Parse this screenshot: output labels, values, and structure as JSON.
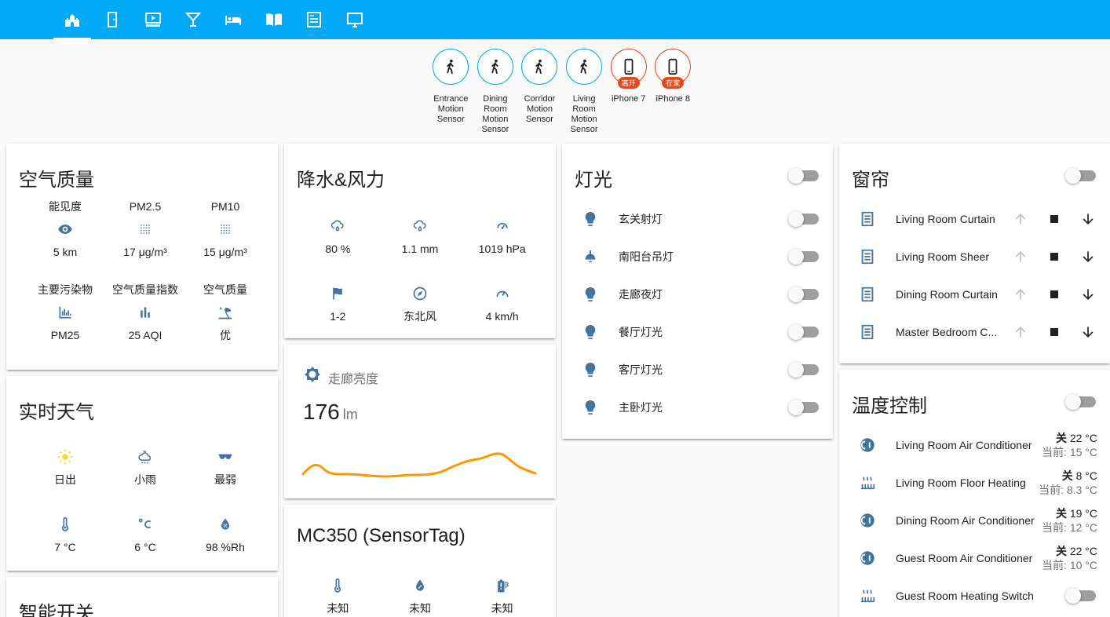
{
  "tabs": [
    {
      "icon": "home-castle-icon",
      "active": true
    },
    {
      "icon": "door-icon"
    },
    {
      "icon": "theater-icon"
    },
    {
      "icon": "glass-cocktail-icon"
    },
    {
      "icon": "bed-icon"
    },
    {
      "icon": "book-open-icon"
    },
    {
      "icon": "washing-machine-icon"
    },
    {
      "icon": "monitor-icon"
    }
  ],
  "badges": [
    {
      "label": "Entrance Motion Sensor",
      "icon": "walk-icon"
    },
    {
      "label": "Dining Room Motion Sensor",
      "icon": "walk-icon"
    },
    {
      "label": "Corridor Motion Sensor",
      "icon": "walk-icon"
    },
    {
      "label": "Living Room Motion Sensor",
      "icon": "walk-icon"
    },
    {
      "label": "iPhone 7",
      "icon": "cellphone-icon",
      "tag": "离开"
    },
    {
      "label": "iPhone 8",
      "icon": "cellphone-icon",
      "tag": "在家"
    }
  ],
  "air": {
    "title": "空气质量",
    "row1": [
      {
        "label": "能见度",
        "icon": "eye-icon",
        "value": "5 km"
      },
      {
        "label": "PM2.5",
        "icon": "dots-grid-icon",
        "value": "17 μg/m³"
      },
      {
        "label": "PM10",
        "icon": "dots-grid-icon",
        "value": "15 μg/m³"
      }
    ],
    "row2": [
      {
        "label": "主要污染物",
        "icon": "chart-histogram-icon",
        "value": "PM25"
      },
      {
        "label": "空气质量指数",
        "icon": "bar-chart-icon",
        "value": "25 AQI"
      },
      {
        "label": "空气质量",
        "icon": "beach-icon",
        "value": "优"
      }
    ]
  },
  "weather": {
    "title": "实时天气",
    "row1": [
      {
        "icon": "sunny-icon",
        "value": "日出"
      },
      {
        "icon": "partly-rainy-icon",
        "value": "小雨"
      },
      {
        "icon": "sunglasses-icon",
        "value": "最弱"
      }
    ],
    "row2": [
      {
        "icon": "thermometer-icon",
        "value": "7 °C"
      },
      {
        "icon": "temperature-celsius-icon",
        "value": "6 °C"
      },
      {
        "icon": "water-percent-icon",
        "value": "98 %Rh"
      }
    ]
  },
  "smart_switch": {
    "title": "智能开关"
  },
  "rain_wind": {
    "title": "降水&风力",
    "row1": [
      {
        "icon": "cloud-rain-icon",
        "value": "80 %"
      },
      {
        "icon": "cloud-rain-icon",
        "value": "1.1 mm"
      },
      {
        "icon": "gauge-icon",
        "value": "1019 hPa"
      }
    ],
    "row2": [
      {
        "icon": "flag-icon",
        "value": "1-2"
      },
      {
        "icon": "compass-icon",
        "value": "东北风"
      },
      {
        "icon": "speedometer-icon",
        "value": "4 km/h"
      }
    ]
  },
  "brightness": {
    "name": "走廊亮度",
    "value": "176",
    "unit": "lm",
    "icon": "brightness-icon",
    "color": "#ff9800"
  },
  "sensortag": {
    "title": "MC350 (SensorTag)",
    "items": [
      {
        "icon": "thermometer-icon",
        "value": "未知"
      },
      {
        "icon": "water-percent-icon",
        "value": "未知"
      },
      {
        "icon": "battery-bluetooth-icon",
        "value": "未知"
      }
    ]
  },
  "lights": {
    "title": "灯光",
    "items": [
      {
        "name": "玄关射灯",
        "icon": "lightbulb-icon"
      },
      {
        "name": "南阳台吊灯",
        "icon": "ceiling-light-icon"
      },
      {
        "name": "走廊夜灯",
        "icon": "lightbulb-icon"
      },
      {
        "name": "餐厅灯光",
        "icon": "lightbulb-icon"
      },
      {
        "name": "客厅灯光",
        "icon": "lightbulb-icon"
      },
      {
        "name": "主卧灯光",
        "icon": "lightbulb-icon"
      }
    ]
  },
  "curtains": {
    "title": "窗帘",
    "items": [
      {
        "name": "Living Room Curtain"
      },
      {
        "name": "Living Room Sheer"
      },
      {
        "name": "Dining Room Curtain"
      },
      {
        "name": "Master Bedroom C..."
      }
    ]
  },
  "climate": {
    "title": "温度控制",
    "items": [
      {
        "name": "Living Room Air Conditioner",
        "icon": "air-conditioner-icon",
        "state": "关",
        "target": "22 °C",
        "current": "当前: 15 °C"
      },
      {
        "name": "Living Room Floor Heating",
        "icon": "radiator-icon",
        "state": "关",
        "target": "8 °C",
        "current": "当前: 8.3 °C"
      },
      {
        "name": "Dining Room Air Conditioner",
        "icon": "air-conditioner-icon",
        "state": "关",
        "target": "19 °C",
        "current": "当前: 12 °C"
      },
      {
        "name": "Guest Room Air Conditioner",
        "icon": "air-conditioner-icon",
        "state": "关",
        "target": "22 °C",
        "current": "当前: 10 °C"
      },
      {
        "name": "Guest Room Heating Switch",
        "icon": "radiator-icon",
        "toggle": true
      }
    ]
  },
  "colors": {
    "primary": "#03a9f4",
    "icon": "#44739e",
    "accent_red": "#df4c1e"
  }
}
